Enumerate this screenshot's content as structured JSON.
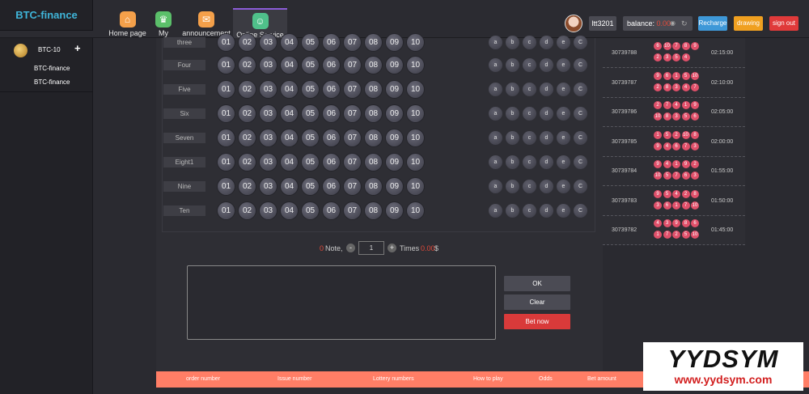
{
  "brand": "BTC-finance",
  "nav": [
    {
      "label": "Home page",
      "icon": "home-icon",
      "color": "#f4a04a"
    },
    {
      "label": "My",
      "icon": "crown-icon",
      "color": "#5bbf6a"
    },
    {
      "label": "announcement",
      "icon": "mail-icon",
      "color": "#f4a04a"
    },
    {
      "label": "Online Service",
      "icon": "support-icon",
      "color": "#4fc08a"
    }
  ],
  "user": {
    "username": "ltt3201",
    "balance_label": "balance:",
    "balance_value": "0.00",
    "recharge": "Recharge",
    "drawing": "drawing",
    "signout": "sign out"
  },
  "sidebar": {
    "game": "BTC-10",
    "plus": "+",
    "items": [
      "BTC-finance",
      "BTC-finance"
    ]
  },
  "board": {
    "rows": [
      "three",
      "Four",
      "Five",
      "Six",
      "Seven",
      "Eight1",
      "Nine",
      "Ten"
    ],
    "numbers": [
      "01",
      "02",
      "03",
      "04",
      "05",
      "06",
      "07",
      "08",
      "09",
      "10"
    ],
    "shortcuts": [
      "a",
      "b",
      "c",
      "d",
      "e",
      "C"
    ]
  },
  "note": {
    "count": "0",
    "label": "Note,",
    "minus": "-",
    "plus": "+",
    "qty": "1",
    "times_label": "Times",
    "times_value": "0.00",
    "currency": "$"
  },
  "actions": {
    "ok": "OK",
    "clear": "Clear",
    "betnow": "Bet now"
  },
  "table_header": [
    "order number",
    "Issue number",
    "Lottery numbers",
    "How to play",
    "Odds",
    "Bet amount"
  ],
  "results": [
    {
      "issue": "30739788",
      "time": "02:15:00",
      "balls": [
        "6",
        "10",
        "7",
        "8",
        "9",
        "2",
        "3",
        "5",
        "4",
        ""
      ]
    },
    {
      "issue": "30739787",
      "time": "02:10:00",
      "balls": [
        "9",
        "6",
        "1",
        "5",
        "10",
        "2",
        "8",
        "3",
        "4",
        "7"
      ]
    },
    {
      "issue": "30739786",
      "time": "02:05:00",
      "balls": [
        "2",
        "7",
        "4",
        "1",
        "9",
        "10",
        "8",
        "3",
        "5",
        "6"
      ]
    },
    {
      "issue": "30739785",
      "time": "02:00:00",
      "balls": [
        "1",
        "5",
        "2",
        "10",
        "8",
        "9",
        "4",
        "6",
        "7",
        "3"
      ]
    },
    {
      "issue": "30739784",
      "time": "01:55:00",
      "balls": [
        "9",
        "4",
        "1",
        "9",
        "2",
        "10",
        "5",
        "7",
        "6",
        "3"
      ]
    },
    {
      "issue": "30739783",
      "time": "01:50:00",
      "balls": [
        "9",
        "5",
        "4",
        "2",
        "8",
        "3",
        "6",
        "1",
        "7",
        "10"
      ]
    },
    {
      "issue": "30739782",
      "time": "01:45:00",
      "balls": [
        "4",
        "3",
        "9",
        "8",
        "6",
        "1",
        "7",
        "2",
        "5",
        "10"
      ]
    }
  ],
  "watermark": {
    "name": "YYDSYM",
    "url": "www.yydsym.com"
  }
}
